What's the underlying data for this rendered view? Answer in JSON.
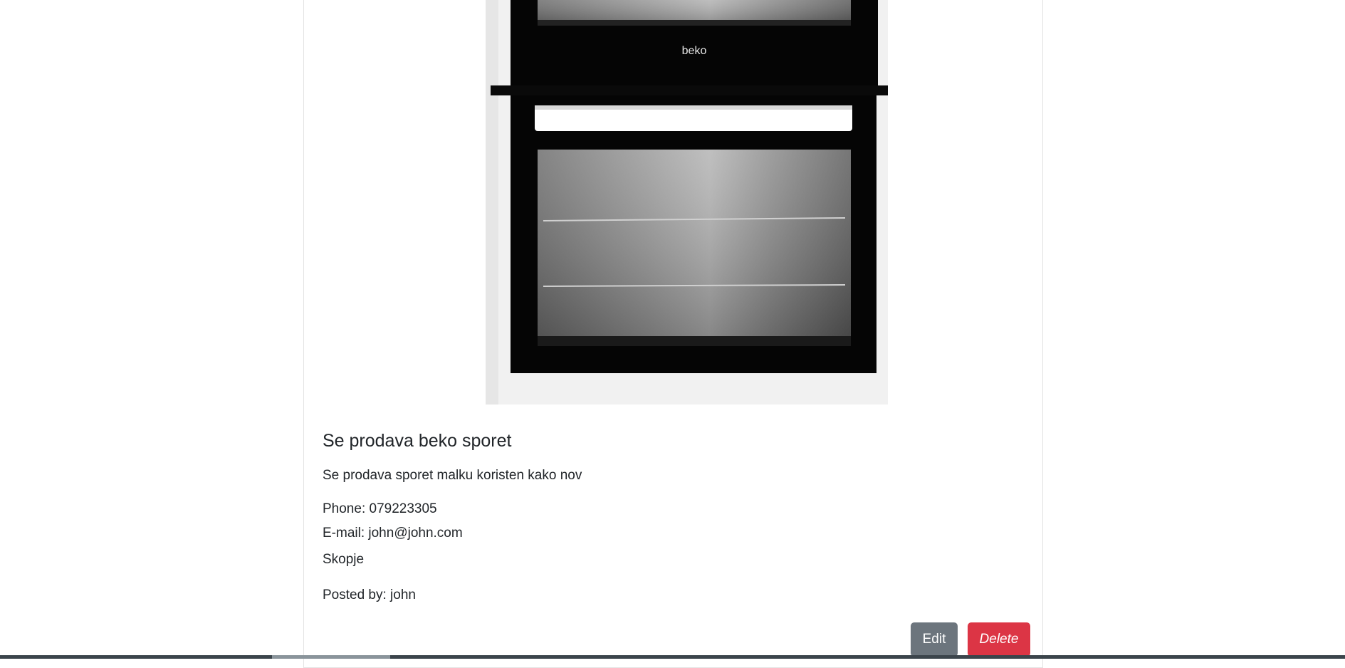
{
  "listing": {
    "title": "Se prodava beko sporet",
    "description": "Se prodava sporet malku koristen kako nov",
    "phone": "Phone: 079223305",
    "email": "E-mail: john@john.com",
    "city": "Skopje",
    "posted_by": "Posted by: john",
    "image_logo_text": "beko"
  },
  "actions": {
    "edit_label": "Edit",
    "delete_label": "Delete"
  },
  "colors": {
    "edit_button": "#6c757d",
    "delete_button": "#dc3545"
  }
}
